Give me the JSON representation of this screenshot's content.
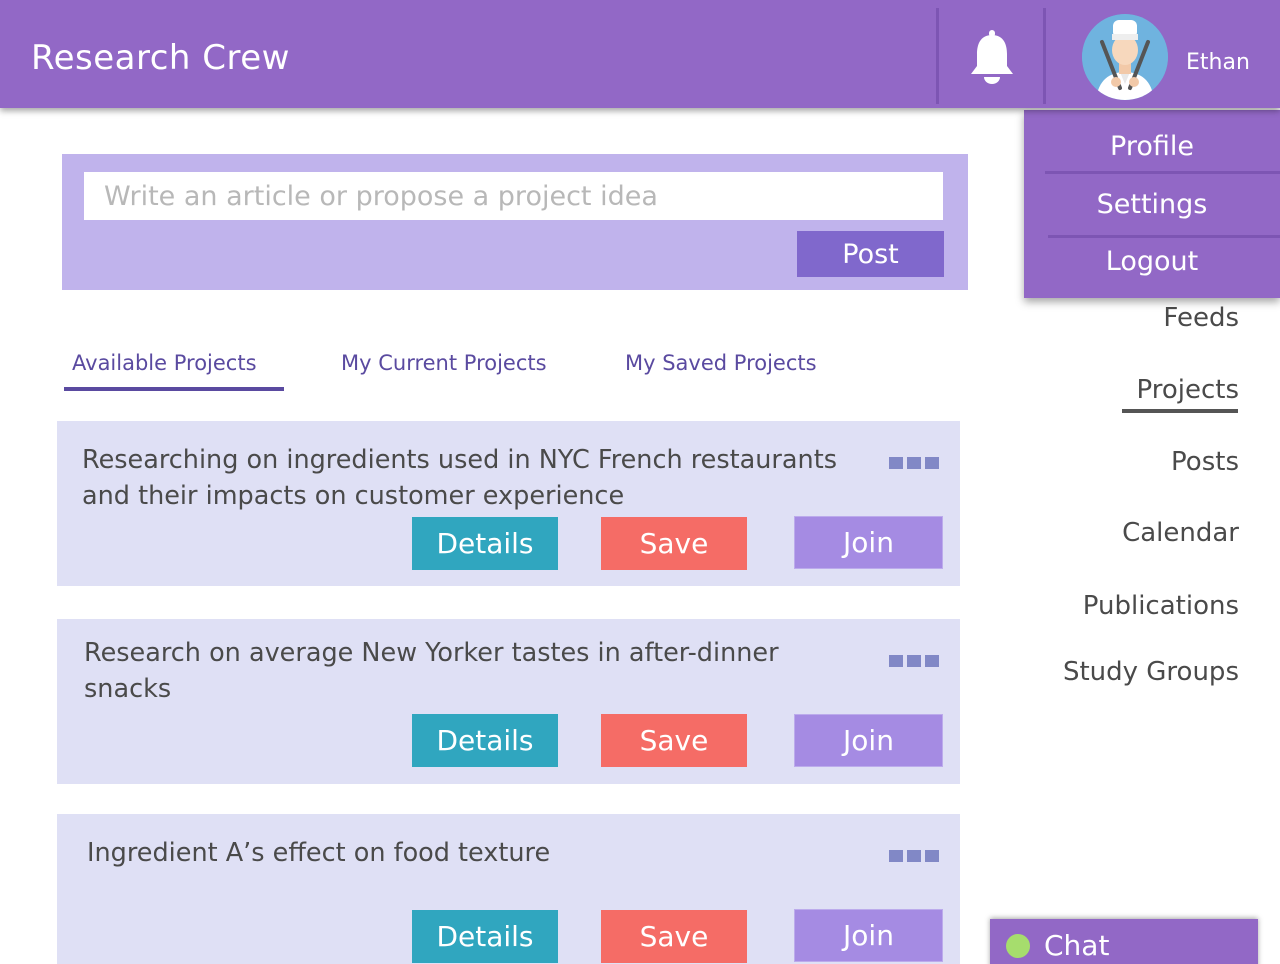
{
  "header": {
    "brand": "Research Crew",
    "username": "Ethan",
    "bg_color": "#9268c6",
    "icons": [
      "bell-icon",
      "avatar"
    ]
  },
  "dropdown": {
    "items": [
      {
        "label": "Profile"
      },
      {
        "label": "Settings"
      },
      {
        "label": "Logout"
      }
    ]
  },
  "composer": {
    "placeholder": "Write an article or propose a project idea",
    "value": "",
    "post_label": "Post"
  },
  "tabs": [
    {
      "label": "Available Projects",
      "active": true
    },
    {
      "label": "My Current Projects",
      "active": false
    },
    {
      "label": "My Saved Projects",
      "active": false
    }
  ],
  "projects": [
    {
      "title_lines": [
        "Researching on ingredients used in NYC French restaurants",
        "and their impacts on customer experience"
      ],
      "details_label": "Details",
      "save_label": "Save",
      "join_label": "Join"
    },
    {
      "title_lines": [
        "Research on average New Yorker tastes in after-dinner",
        "snacks"
      ],
      "details_label": "Details",
      "save_label": "Save",
      "join_label": "Join"
    },
    {
      "title_lines": [
        "Ingredient A’s effect on food texture"
      ],
      "details_label": "Details",
      "save_label": "Save",
      "join_label": "Join"
    }
  ],
  "sidebar": {
    "items": [
      {
        "label": "Feeds",
        "active": false
      },
      {
        "label": "Projects",
        "active": true
      },
      {
        "label": "Posts",
        "active": false
      },
      {
        "label": "Calendar",
        "active": false
      },
      {
        "label": "Publications",
        "active": false
      },
      {
        "label": "Study Groups",
        "active": false
      }
    ]
  },
  "chat": {
    "label": "Chat",
    "status": "online",
    "status_color": "#a6dd6d"
  },
  "colors": {
    "accent": "#9268c6",
    "details_button": "#30a6bf",
    "save_button": "#f56c66",
    "join_button": "#a58be3",
    "card_bg": "#dfe0f5",
    "composer_bg": "#c0b3ec"
  }
}
